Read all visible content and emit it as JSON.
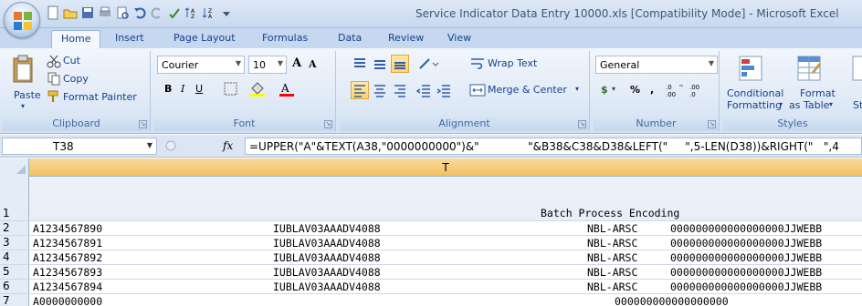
{
  "window": {
    "title": "Service Indicator Data Entry 10000.xls  [Compatibility Mode]  -  Microsoft Excel"
  },
  "ribbon_tabs": [
    "Home",
    "Insert",
    "Page Layout",
    "Formulas",
    "Data",
    "Review",
    "View"
  ],
  "clipboard": {
    "paste": "Paste",
    "cut": "Cut",
    "copy": "Copy",
    "format_painter": "Format Painter",
    "group_label": "Clipboard"
  },
  "font": {
    "family": "Courier",
    "size": "10",
    "group_label": "Font",
    "bold": "B",
    "italic": "I",
    "underline": "U",
    "grow": "A",
    "shrink": "A"
  },
  "alignment": {
    "wrap_text": "Wrap Text",
    "merge_center": "Merge & Center",
    "group_label": "Alignment"
  },
  "number": {
    "format": "General",
    "currency": "$",
    "percent": "%",
    "comma": ",",
    "group_label": "Number"
  },
  "styles": {
    "conditional": "Conditional",
    "formatting": "Formatting",
    "format": "Format",
    "as_table": "as Table",
    "cell_styles_partial": "St",
    "group_label": "Styles"
  },
  "formula_bar": {
    "name_box": "T38",
    "fx": "fx",
    "formula": "=UPPER(\"A\"&TEXT(A38,\"0000000000\")&\"              \"&B38&C38&D38&LEFT(\"     \",5-LEN(D38))&RIGHT(\"   \",4"
  },
  "grid": {
    "column_header": "T",
    "rows": [
      {
        "num": "1",
        "a": "",
        "b": "",
        "c": "Batch Process Encoding",
        "d": ""
      },
      {
        "num": "2",
        "a": "A1234567890",
        "b": "IUBLAV03AAADV4088",
        "c": "NBL-ARSC",
        "d": "000000000000000000JJWEBB"
      },
      {
        "num": "3",
        "a": "A1234567891",
        "b": "IUBLAV03AAADV4088",
        "c": "NBL-ARSC",
        "d": "000000000000000000JJWEBB"
      },
      {
        "num": "4",
        "a": "A1234567892",
        "b": "IUBLAV03AAADV4088",
        "c": "NBL-ARSC",
        "d": "000000000000000000JJWEBB"
      },
      {
        "num": "5",
        "a": "A1234567893",
        "b": "IUBLAV03AAADV4088",
        "c": "NBL-ARSC",
        "d": "000000000000000000JJWEBB"
      },
      {
        "num": "6",
        "a": "A1234567894",
        "b": "IUBLAV03AAADV4088",
        "c": "NBL-ARSC",
        "d": "000000000000000000JJWEBB"
      },
      {
        "num": "7",
        "a": "A0000000000",
        "b": "",
        "c": "",
        "d": "000000000000000000"
      }
    ]
  },
  "colors": {
    "ribbon_text": "#15428b",
    "active_column_header": "#f1c15f",
    "selected_button": "#ffd36b"
  }
}
